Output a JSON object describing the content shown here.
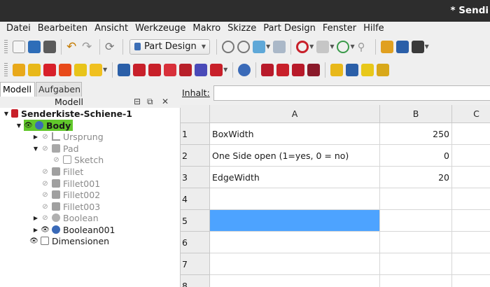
{
  "window": {
    "title": "* Sendi"
  },
  "menu": [
    "Datei",
    "Bearbeiten",
    "Ansicht",
    "Werkzeuge",
    "Makro",
    "Skizze",
    "Part Design",
    "Fenster",
    "Hilfe"
  ],
  "toolbar": {
    "workbench": "Part Design"
  },
  "left_panel": {
    "tabs": [
      "Modell",
      "Aufgaben"
    ],
    "header": "Modell",
    "tree": [
      {
        "label": "Senderkiste-Schiene-1",
        "icon": "document-icon"
      },
      {
        "label": "Body",
        "icon": "body-icon"
      },
      {
        "label": "Ursprung",
        "icon": "origin-icon"
      },
      {
        "label": "Pad",
        "icon": "pad-icon"
      },
      {
        "label": "Sketch",
        "icon": "sketch-icon"
      },
      {
        "label": "Fillet",
        "icon": "fillet-icon"
      },
      {
        "label": "Fillet001",
        "icon": "fillet-icon"
      },
      {
        "label": "Fillet002",
        "icon": "fillet-icon"
      },
      {
        "label": "Fillet003",
        "icon": "fillet-icon"
      },
      {
        "label": "Boolean",
        "icon": "boolean-icon"
      },
      {
        "label": "Boolean001",
        "icon": "boolean-icon"
      },
      {
        "label": "Dimensionen",
        "icon": "spreadsheet-icon"
      }
    ]
  },
  "sheet": {
    "content_label": "Inhalt:",
    "content_value": "",
    "columns": [
      "A",
      "B",
      "C"
    ],
    "row_numbers": [
      "1",
      "2",
      "3",
      "4",
      "5",
      "6",
      "7",
      "8"
    ],
    "rows": [
      {
        "a": "BoxWidth",
        "b": "250"
      },
      {
        "a": "One Side open (1=yes, 0 = no)",
        "b": "0"
      },
      {
        "a": "EdgeWidth",
        "b": "20"
      },
      {
        "a": "",
        "b": ""
      },
      {
        "a": "",
        "b": ""
      },
      {
        "a": "",
        "b": ""
      },
      {
        "a": "",
        "b": ""
      },
      {
        "a": "",
        "b": ""
      }
    ]
  },
  "colors": {
    "accent": "#4da3ff",
    "body_highlight": "#61c72b",
    "titlebar": "#2d2d2d"
  }
}
